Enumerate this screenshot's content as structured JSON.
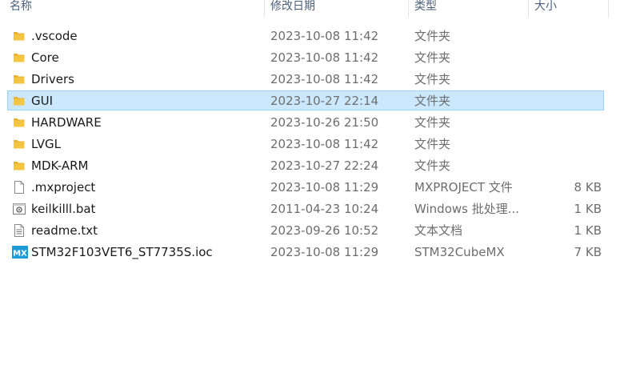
{
  "columns": {
    "name": "名称",
    "date": "修改日期",
    "type": "类型",
    "size": "大小"
  },
  "files": [
    {
      "name": ".vscode",
      "date": "2023-10-08 11:42",
      "type": "文件夹",
      "size": "",
      "icon": "folder-icon"
    },
    {
      "name": "Core",
      "date": "2023-10-08 11:42",
      "type": "文件夹",
      "size": "",
      "icon": "folder-icon"
    },
    {
      "name": "Drivers",
      "date": "2023-10-08 11:42",
      "type": "文件夹",
      "size": "",
      "icon": "folder-icon"
    },
    {
      "name": "GUI",
      "date": "2023-10-27 22:14",
      "type": "文件夹",
      "size": "",
      "icon": "folder-icon",
      "selected": true
    },
    {
      "name": "HARDWARE",
      "date": "2023-10-26 21:50",
      "type": "文件夹",
      "size": "",
      "icon": "folder-icon"
    },
    {
      "name": "LVGL",
      "date": "2023-10-08 11:42",
      "type": "文件夹",
      "size": "",
      "icon": "folder-icon"
    },
    {
      "name": "MDK-ARM",
      "date": "2023-10-27 22:24",
      "type": "文件夹",
      "size": "",
      "icon": "folder-icon"
    },
    {
      "name": ".mxproject",
      "date": "2023-10-08 11:29",
      "type": "MXPROJECT 文件",
      "size": "8 KB",
      "icon": "blank-file-icon"
    },
    {
      "name": "keilkilll.bat",
      "date": "2011-04-23 10:24",
      "type": "Windows 批处理...",
      "size": "1 KB",
      "icon": "batch-file-icon"
    },
    {
      "name": "readme.txt",
      "date": "2023-09-26 10:52",
      "type": "文本文档",
      "size": "1 KB",
      "icon": "text-file-icon"
    },
    {
      "name": "STM32F103VET6_ST7735S.ioc",
      "date": "2023-10-08 11:29",
      "type": "STM32CubeMX",
      "size": "7 KB",
      "icon": "mx-file-icon",
      "icon_label": "MX"
    }
  ],
  "colors": {
    "folder": "#f4c542",
    "selection_bg": "#cce8ff",
    "selection_border": "#99d1ff",
    "mx_badge": "#1e9bd7"
  }
}
